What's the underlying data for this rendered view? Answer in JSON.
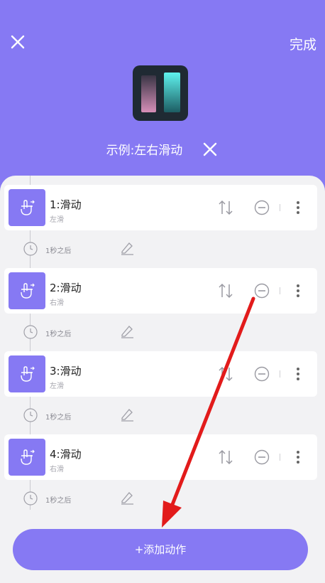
{
  "header": {
    "done_label": "完成",
    "title": "示例:左右滑动",
    "icons": {
      "close": "close-icon",
      "clear": "clear-title-icon",
      "app": "app-icon"
    }
  },
  "actions": [
    {
      "name": "1:滑动",
      "direction": "左滑",
      "delay": "1秒之后"
    },
    {
      "name": "2:滑动",
      "direction": "右滑",
      "delay": "1秒之后"
    },
    {
      "name": "3:滑动",
      "direction": "左滑",
      "delay": "1秒之后"
    },
    {
      "name": "4:滑动",
      "direction": "右滑",
      "delay": "1秒之后"
    }
  ],
  "footer": {
    "add_label": "+添加动作"
  },
  "colors": {
    "accent": "#8679f3",
    "panel": "#f2f2f4",
    "annotation_arrow": "#e21b1b"
  }
}
